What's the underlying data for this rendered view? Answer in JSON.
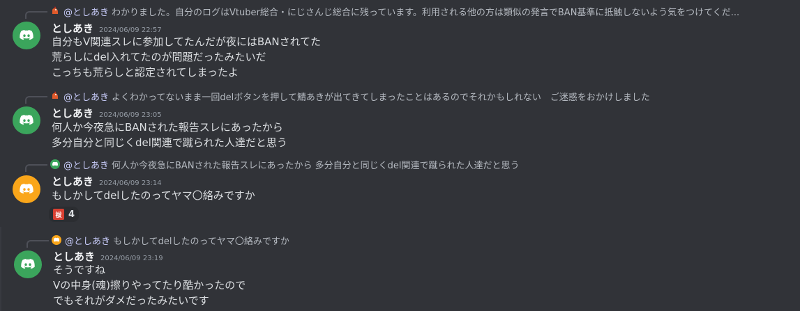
{
  "messages": [
    {
      "reply": {
        "mention": "@としあき",
        "text": "わかりました。自分のログはVtuber総合・にじさんじ総合に残っています。利用される他の方は類似の発言でBAN基準に抵触しないよう気をつけてくだ..."
      },
      "author": "としあき",
      "timestamp": "2024/06/09 22:57",
      "avatar_color": "#3ba55c",
      "lines": [
        "自分もV関連スレに参加してたんだが夜にはBANされてた",
        "荒らしにdel入れてたのが問題だったみたいだ",
        "こっちも荒らしと認定されてしまったよ"
      ]
    },
    {
      "reply": {
        "mention": "@としあき",
        "text": "よくわかってないまま一回delボタンを押して鯖あきが出てきてしまったことはあるのでそれかもしれない　ご迷惑をおかけしました"
      },
      "author": "としあき",
      "timestamp": "2024/06/09 23:05",
      "avatar_color": "#3ba55c",
      "lines": [
        "何人か今夜急にBANされた報告スレにあったから",
        "多分自分と同じくdel関連で蹴られた人達だと思う"
      ]
    },
    {
      "reply": {
        "mention": "@としあき",
        "text": "何人か今夜急にBANされた報告スレにあったから 多分自分と同じくdel関連で蹴られた人達だと思う"
      },
      "author": "としあき",
      "timestamp": "2024/06/09 23:14",
      "avatar_color": "#faa61a",
      "lines": [
        "もしかしてdelしたのってヤマ〇絡みですか"
      ],
      "reaction": {
        "emoji_label": "祓",
        "count": "4"
      }
    },
    {
      "reply": {
        "mention": "@としあき",
        "text": "もしかしてdelしたのってヤマ〇絡みですか"
      },
      "author": "としあき",
      "timestamp": "2024/06/09 23:19",
      "avatar_color": "#3ba55c",
      "lines": [
        "そうですね",
        "Vの中身(魂)擦りやってたり酷かったので",
        "でもそれがダメだったみたいです"
      ]
    }
  ],
  "colors": {
    "background": "#313338",
    "green_avatar": "#3ba55c",
    "orange_avatar": "#faa61a",
    "mention": "#c9cdfb"
  },
  "icons": {
    "avatar": "discord-logo-icon",
    "reply_avatar_1": "rooster-icon",
    "reply_avatar_2": "rooster-icon",
    "reply_avatar_3": "discord-logo-icon",
    "reply_avatar_4": "discord-logo-icon"
  }
}
